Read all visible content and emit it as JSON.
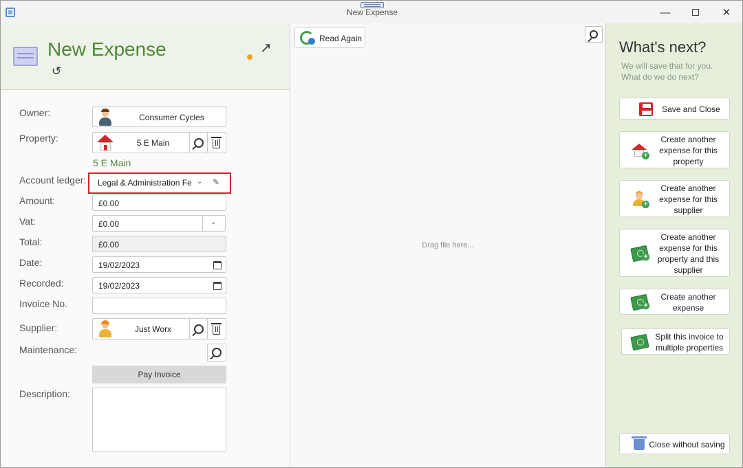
{
  "window": {
    "title": "New Expense"
  },
  "header": {
    "title": "New Expense"
  },
  "form": {
    "owner": {
      "label": "Owner:",
      "value": "Consumer Cycles"
    },
    "property": {
      "label": "Property:",
      "value": "5 E Main",
      "link": "5 E Main"
    },
    "account_ledger": {
      "label": "Account ledger:",
      "value": "Legal & Administration Fe"
    },
    "amount": {
      "label": "Amount:",
      "value": "£0.00"
    },
    "vat": {
      "label": "Vat:",
      "value": "£0.00"
    },
    "total": {
      "label": "Total:",
      "value": "£0.00"
    },
    "date": {
      "label": "Date:",
      "value": "19/02/2023"
    },
    "recorded": {
      "label": "Recorded:",
      "value": "19/02/2023"
    },
    "invoice_no": {
      "label": "Invoice No.",
      "value": ""
    },
    "supplier": {
      "label": "Supplier:",
      "value": "Just Worx"
    },
    "maintenance": {
      "label": "Maintenance:"
    },
    "pay_invoice_label": "Pay Invoice",
    "description": {
      "label": "Description:",
      "value": ""
    }
  },
  "document_panel": {
    "read_again_label": "Read Again",
    "drop_hint": "Drag file here..."
  },
  "next_panel": {
    "title": "What's next?",
    "subtitle_line1": "We will save that for you.",
    "subtitle_line2": "What do we do next?",
    "actions": {
      "save_close": "Save and Close",
      "another_property_l1": "Create another",
      "another_property_l2": "expense for this",
      "another_property_l3": "property",
      "another_supplier_l1": "Create another",
      "another_supplier_l2": "expense for this",
      "another_supplier_l3": "supplier",
      "another_both_l1": "Create another",
      "another_both_l2": "expense for this",
      "another_both_l3": "property and this",
      "another_both_l4": "supplier",
      "another_l1": "Create another",
      "another_l2": "expense",
      "split_l1": "Split this invoice to",
      "split_l2": "multiple properties",
      "close_without_saving": "Close without saving"
    }
  },
  "colors": {
    "accent_green": "#4d8a35",
    "highlight_red": "#d6202c",
    "unsaved_dot": "#f2a11f",
    "right_panel_bg": "#e6efdc"
  }
}
